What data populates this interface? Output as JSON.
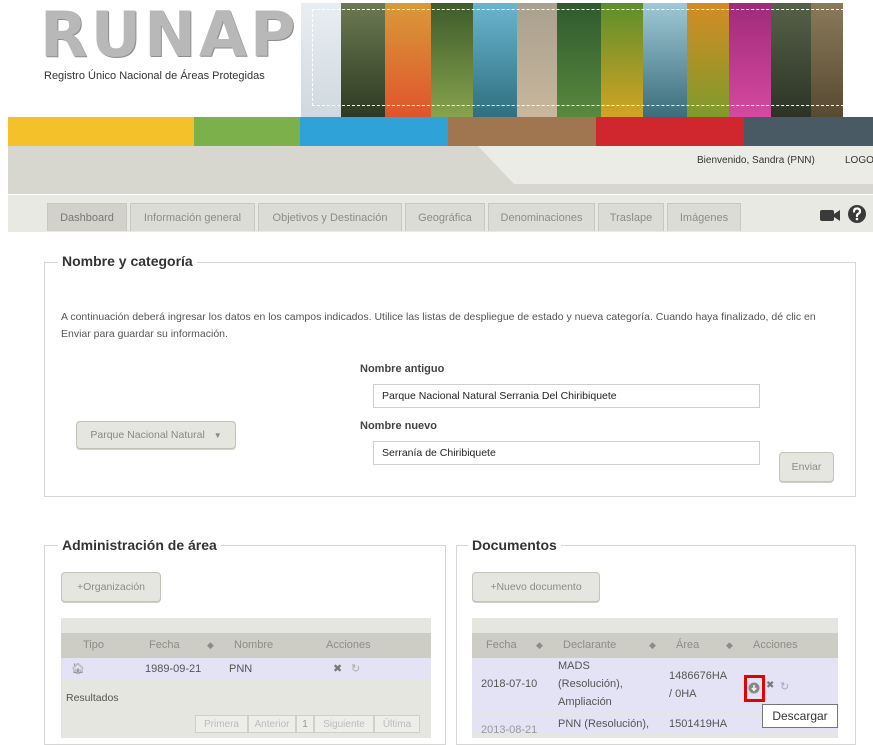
{
  "header": {
    "logo": "RUNAP",
    "subtitle": "Registro Único Nacional de Áreas Protegidas",
    "welcome": "Bienvenido, Sandra (PNN)",
    "logout": "LOGOU"
  },
  "tabs": [
    "Dashboard",
    "Información general",
    "Objetivos y Destinación",
    "Geográfica",
    "Denominaciones",
    "Traslape",
    "Imágenes"
  ],
  "toolbar_icons": [
    "video-camera-icon",
    "help-icon"
  ],
  "nombre": {
    "title": "Nombre y categoría",
    "instructions": "A continuación deberá ingresar los datos en los campos indicados. Utilice las listas de despliegue de estado y nueva categoría. Cuando haya finalizado, dé clic en Enviar para guardar su información.",
    "category_select": "Parque Nacional Natural",
    "old_label": "Nombre antiguo",
    "old_value": "Parque Nacional Natural Serrania Del Chiribiquete",
    "new_label": "Nombre nuevo",
    "new_value": "Serranía de Chiribiquete",
    "submit": "Enviar"
  },
  "admin": {
    "title": "Administración de área",
    "add_button": "+Organización",
    "columns": [
      "Tipo",
      "Fecha",
      "Nombre",
      "Acciones"
    ],
    "rows": [
      {
        "fecha": "1989-09-21",
        "nombre": "PNN"
      }
    ],
    "results_label": "Resultados",
    "pager": [
      "Primera",
      "Anterior",
      "1",
      "Siguiente",
      "Última"
    ]
  },
  "docs": {
    "title": "Documentos",
    "add_button": "+Nuevo documento",
    "columns": [
      "Fecha",
      "Declarante",
      "Área",
      "Acciones"
    ],
    "rows": [
      {
        "fecha": "2018-07-10",
        "declarante_1": "MADS",
        "declarante_2": "(Resolución),",
        "declarante_3": "Ampliación",
        "area_1": "1486676HA",
        "area_2": "/ 0HA"
      },
      {
        "fecha": "2013-08-21",
        "declarante_1": "PNN (Resolución),",
        "area_1": "1501419HA"
      }
    ],
    "tooltip": "Descargar"
  },
  "colors": {
    "colorbar": [
      "#f5c12b",
      "#7bb04a",
      "#2fa3d8",
      "#a07650",
      "#d0262e",
      "#4a5a64"
    ],
    "highlight": "#e60000"
  }
}
